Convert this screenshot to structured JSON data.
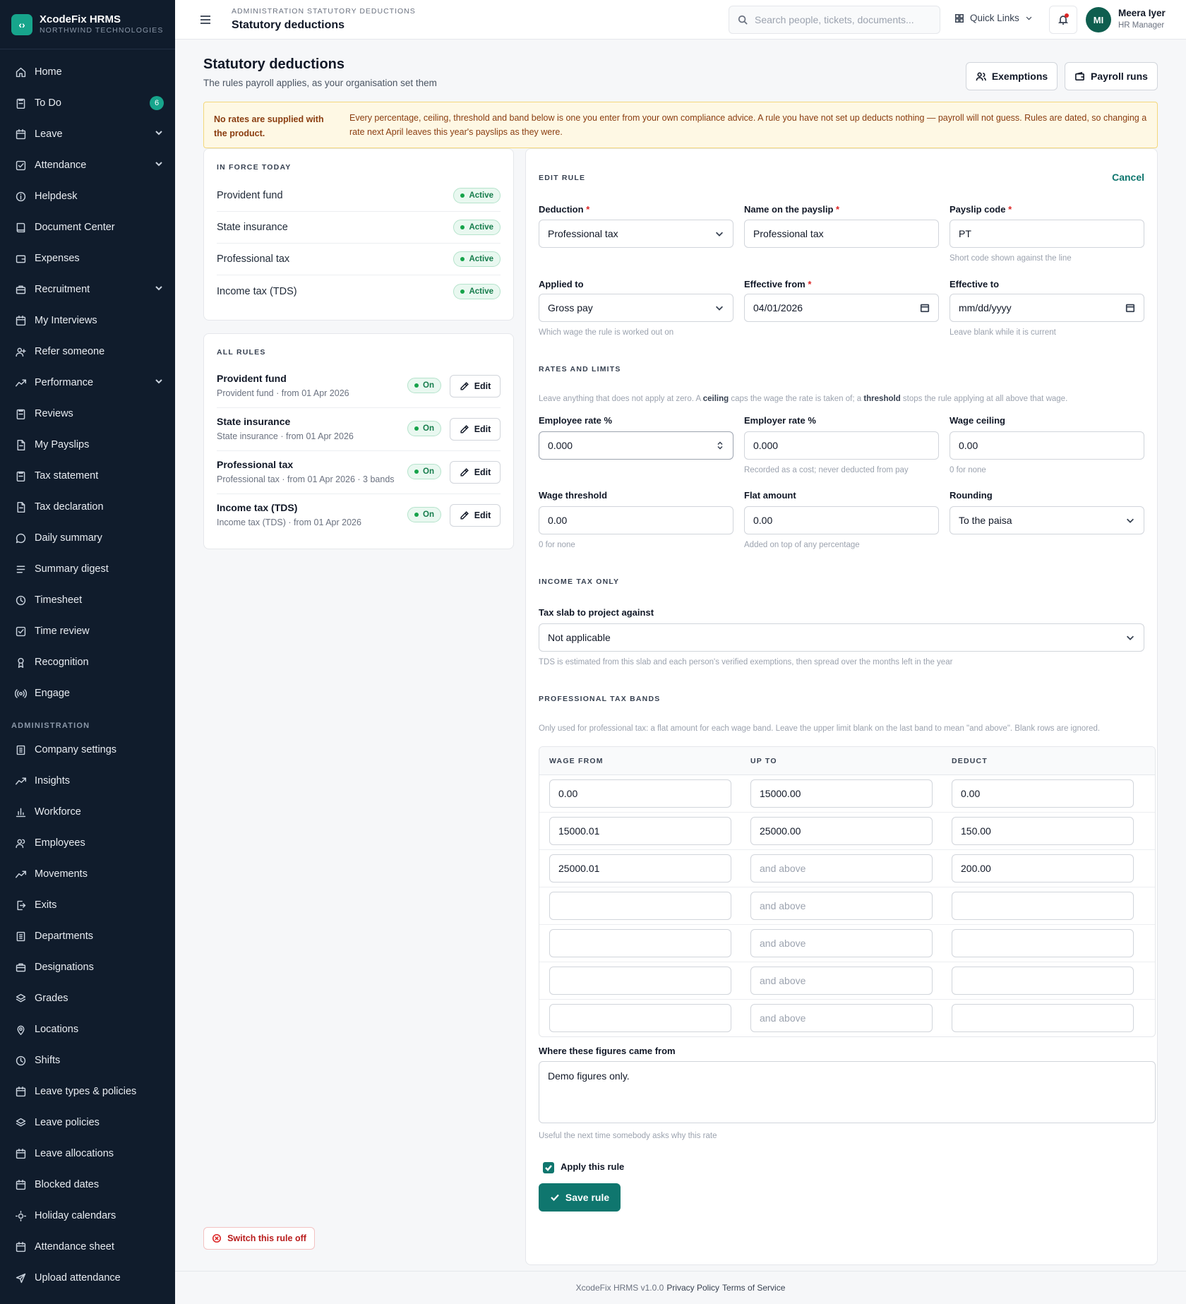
{
  "brand": {
    "name": "XcodeFix HRMS",
    "org": "NORTHWIND TECHNOLOGIES",
    "logo_glyph": "‹›"
  },
  "sidebar": {
    "items": [
      {
        "label": "Home",
        "icon": "home-icon"
      },
      {
        "label": "To Do",
        "icon": "clipboard-icon",
        "badge": "6"
      },
      {
        "label": "Leave",
        "icon": "calendar-icon",
        "chevron": true
      },
      {
        "label": "Attendance",
        "icon": "check-square-icon",
        "chevron": true
      },
      {
        "label": "Helpdesk",
        "icon": "info-icon"
      },
      {
        "label": "Document Center",
        "icon": "book-icon"
      },
      {
        "label": "Expenses",
        "icon": "wallet-icon"
      },
      {
        "label": "Recruitment",
        "icon": "briefcase-icon",
        "chevron": true
      },
      {
        "label": "My Interviews",
        "icon": "calendar-icon"
      },
      {
        "label": "Refer someone",
        "icon": "user-plus-icon"
      },
      {
        "label": "Performance",
        "icon": "trend-icon",
        "chevron": true
      },
      {
        "label": "Reviews",
        "icon": "clipboard-icon"
      },
      {
        "label": "My Payslips",
        "icon": "file-icon"
      },
      {
        "label": "Tax statement",
        "icon": "clipboard-icon"
      },
      {
        "label": "Tax declaration",
        "icon": "file-icon"
      },
      {
        "label": "Daily summary",
        "icon": "chat-icon"
      },
      {
        "label": "Summary digest",
        "icon": "list-icon"
      },
      {
        "label": "Timesheet",
        "icon": "clock-icon"
      },
      {
        "label": "Time review",
        "icon": "check-square-icon"
      },
      {
        "label": "Recognition",
        "icon": "award-icon"
      },
      {
        "label": "Engage",
        "icon": "broadcast-icon"
      }
    ],
    "admin_section": "ADMINISTRATION",
    "admin_items": [
      {
        "label": "Company settings",
        "icon": "building-icon"
      },
      {
        "label": "Insights",
        "icon": "trend-icon"
      },
      {
        "label": "Workforce",
        "icon": "bar-chart-icon"
      },
      {
        "label": "Employees",
        "icon": "users-icon"
      },
      {
        "label": "Movements",
        "icon": "trend-icon"
      },
      {
        "label": "Exits",
        "icon": "logout-icon"
      },
      {
        "label": "Departments",
        "icon": "building-icon"
      },
      {
        "label": "Designations",
        "icon": "briefcase-icon"
      },
      {
        "label": "Grades",
        "icon": "layers-icon"
      },
      {
        "label": "Locations",
        "icon": "pin-icon"
      },
      {
        "label": "Shifts",
        "icon": "clock-icon"
      },
      {
        "label": "Leave types & policies",
        "icon": "calendar-icon"
      },
      {
        "label": "Leave policies",
        "icon": "layers-icon"
      },
      {
        "label": "Leave allocations",
        "icon": "calendar-icon"
      },
      {
        "label": "Blocked dates",
        "icon": "calendar-icon"
      },
      {
        "label": "Holiday calendars",
        "icon": "sun-icon"
      },
      {
        "label": "Attendance sheet",
        "icon": "calendar-icon"
      },
      {
        "label": "Upload attendance",
        "icon": "send-icon"
      }
    ]
  },
  "topbar": {
    "breadcrumb": "ADMINISTRATION STATUTORY DEDUCTIONS",
    "title": "Statutory deductions",
    "search_placeholder": "Search people, tickets, documents...",
    "quick_links": "Quick Links",
    "user": {
      "initials": "MI",
      "name": "Meera Iyer",
      "role": "HR Manager"
    }
  },
  "page": {
    "title": "Statutory deductions",
    "subtitle": "The rules payroll applies, as your organisation set them",
    "exemptions_btn": "Exemptions",
    "payroll_runs_btn": "Payroll runs",
    "warning_strong": "No rates are supplied with the product.",
    "warning_text": "Every percentage, ceiling, threshold and band below is one you enter from your own compliance advice. A rule you have not set up deducts nothing — payroll will not guess. Rules are dated, so changing a rate next April leaves this year's payslips as they were."
  },
  "in_force": {
    "title": "IN FORCE TODAY",
    "rows": [
      {
        "name": "Provident fund",
        "status": "Active"
      },
      {
        "name": "State insurance",
        "status": "Active"
      },
      {
        "name": "Professional tax",
        "status": "Active"
      },
      {
        "name": "Income tax (TDS)",
        "status": "Active"
      }
    ]
  },
  "all_rules": {
    "title": "ALL RULES",
    "edit_label": "Edit",
    "rows": [
      {
        "name": "Provident fund",
        "meta": "Provident fund · from 01 Apr 2026",
        "status": "On"
      },
      {
        "name": "State insurance",
        "meta": "State insurance · from 01 Apr 2026",
        "status": "On"
      },
      {
        "name": "Professional tax",
        "meta": "Professional tax · from 01 Apr 2026 · 3 bands",
        "status": "On"
      },
      {
        "name": "Income tax (TDS)",
        "meta": "Income tax (TDS) · from 01 Apr 2026",
        "status": "On"
      }
    ]
  },
  "switch_off": "Switch this rule off",
  "edit": {
    "title": "EDIT RULE",
    "cancel": "Cancel",
    "deduction": {
      "label": "Deduction",
      "value": "Professional tax"
    },
    "payslip_name": {
      "label": "Name on the payslip",
      "value": "Professional tax"
    },
    "payslip_code": {
      "label": "Payslip code",
      "value": "PT",
      "hint": "Short code shown against the line"
    },
    "applied_to": {
      "label": "Applied to",
      "value": "Gross pay",
      "hint": "Which wage the rule is worked out on"
    },
    "effective_from": {
      "label": "Effective from",
      "value": "04/01/2026"
    },
    "effective_to": {
      "label": "Effective to",
      "placeholder": "mm/dd/yyyy",
      "hint": "Leave blank while it is current"
    },
    "rates_title": "RATES AND LIMITS",
    "rates_hint_a": "Leave anything that does not apply at zero. A ",
    "rates_hint_ceiling": "ceiling",
    "rates_hint_b": " caps the wage the rate is taken of; a ",
    "rates_hint_threshold": "threshold",
    "rates_hint_c": " stops the rule applying at all above that wage.",
    "employee_rate": {
      "label": "Employee rate %",
      "value": "0.000"
    },
    "employer_rate": {
      "label": "Employer rate %",
      "value": "0.000",
      "hint": "Recorded as a cost; never deducted from pay"
    },
    "wage_ceiling": {
      "label": "Wage ceiling",
      "value": "0.00",
      "hint": "0 for none"
    },
    "wage_threshold": {
      "label": "Wage threshold",
      "value": "0.00",
      "hint": "0 for none"
    },
    "flat_amount": {
      "label": "Flat amount",
      "value": "0.00",
      "hint": "Added on top of any percentage"
    },
    "rounding": {
      "label": "Rounding",
      "value": "To the paisa"
    },
    "income_tax_title": "INCOME TAX ONLY",
    "tax_slab": {
      "label": "Tax slab to project against",
      "value": "Not applicable",
      "hint": "TDS is estimated from this slab and each person's verified exemptions, then spread over the months left in the year"
    },
    "bands_title": "PROFESSIONAL TAX BANDS",
    "bands_hint": "Only used for professional tax: a flat amount for each wage band. Leave the upper limit blank on the last band to mean \"and above\". Blank rows are ignored.",
    "bands_headers": [
      "WAGE FROM",
      "UP TO",
      "DEDUCT"
    ],
    "and_above": "and above",
    "bands": [
      {
        "from": "0.00",
        "to": "15000.00",
        "deduct": "0.00"
      },
      {
        "from": "15000.01",
        "to": "25000.00",
        "deduct": "150.00"
      },
      {
        "from": "25000.01",
        "to": "",
        "deduct": "200.00"
      },
      {
        "from": "",
        "to": "",
        "deduct": ""
      },
      {
        "from": "",
        "to": "",
        "deduct": ""
      },
      {
        "from": "",
        "to": "",
        "deduct": ""
      },
      {
        "from": "",
        "to": "",
        "deduct": ""
      }
    ],
    "source": {
      "label": "Where these figures came from",
      "value": "Demo figures only.",
      "hint": "Useful the next time somebody asks why this rate"
    },
    "apply_label": "Apply this rule",
    "apply_checked": true,
    "save_label": "Save rule"
  },
  "footer": {
    "version": "XcodeFix HRMS v1.0.0",
    "privacy": "Privacy Policy",
    "terms": "Terms of Service"
  }
}
